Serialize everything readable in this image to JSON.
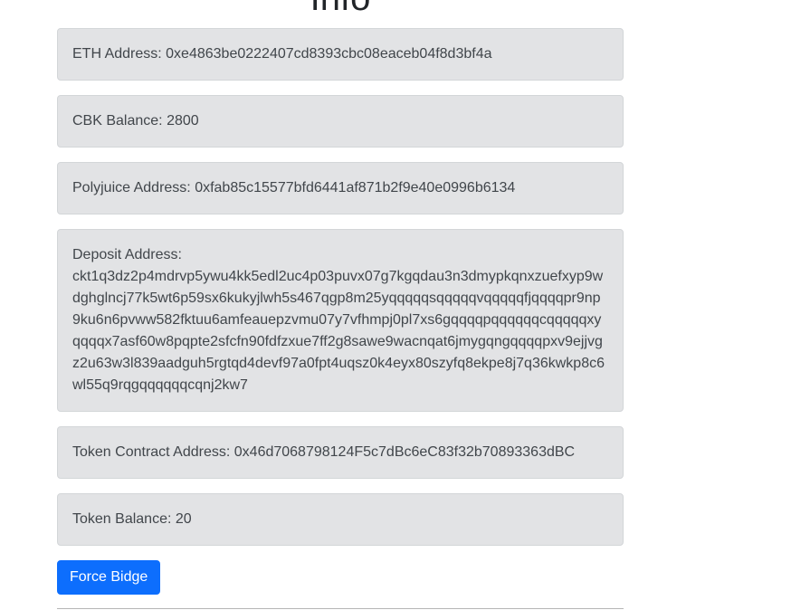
{
  "page": {
    "heading": "Info"
  },
  "info": {
    "eth": {
      "label": "ETH Address: ",
      "value": "0xe4863be0222407cd8393cbc08eaceb04f8d3bf4a"
    },
    "cbk": {
      "label": "CBK Balance: ",
      "value": "2800"
    },
    "polyjuice": {
      "label": "Polyjuice Address: ",
      "value": "0xfab85c15577bfd6441af871b2f9e40e0996b6134"
    },
    "deposit": {
      "label": "Deposit Address:",
      "value": "ckt1q3dz2p4mdrvp5ywu4kk5edl2uc4p03puvx07g7kgqdau3n3dmypkqnxzuefxyp9wdghglncj77k5wt6p59sx6kukyjlwh5s467qgp8m25yqqqqqsqqqqqvqqqqqfjqqqqpr9np9ku6n6pvww582fktuu6amfeauepzvmu07y7vfhmpj0pl7xs6gqqqqpqqqqqqcqqqqqxyqqqqx7asf60w8pqpte2sfcfn90fdfzxue7ff2g8sawe9wacnqat6jmygqngqqqqpxv9ejjvgz2u63w3l839aadguh5rgtqd4devf97a0fpt4uqsz0k4eyx80szyfq8ekpe8j7q36kwkp8c6wl55q9rqgqqqqqqcqnj2kw7"
    },
    "token_contract": {
      "label": "Token Contract Address: ",
      "value": "0x46d7068798124F5c7dBc6eC83f32b70893363dBC"
    },
    "token_balance": {
      "label": "Token Balance: ",
      "value": "20"
    }
  },
  "actions": {
    "force_bridge_label": "Force Bidge"
  },
  "colors": {
    "box_background": "#e2e3e5",
    "box_text": "#41464b",
    "primary_button": "#0d6efd"
  }
}
